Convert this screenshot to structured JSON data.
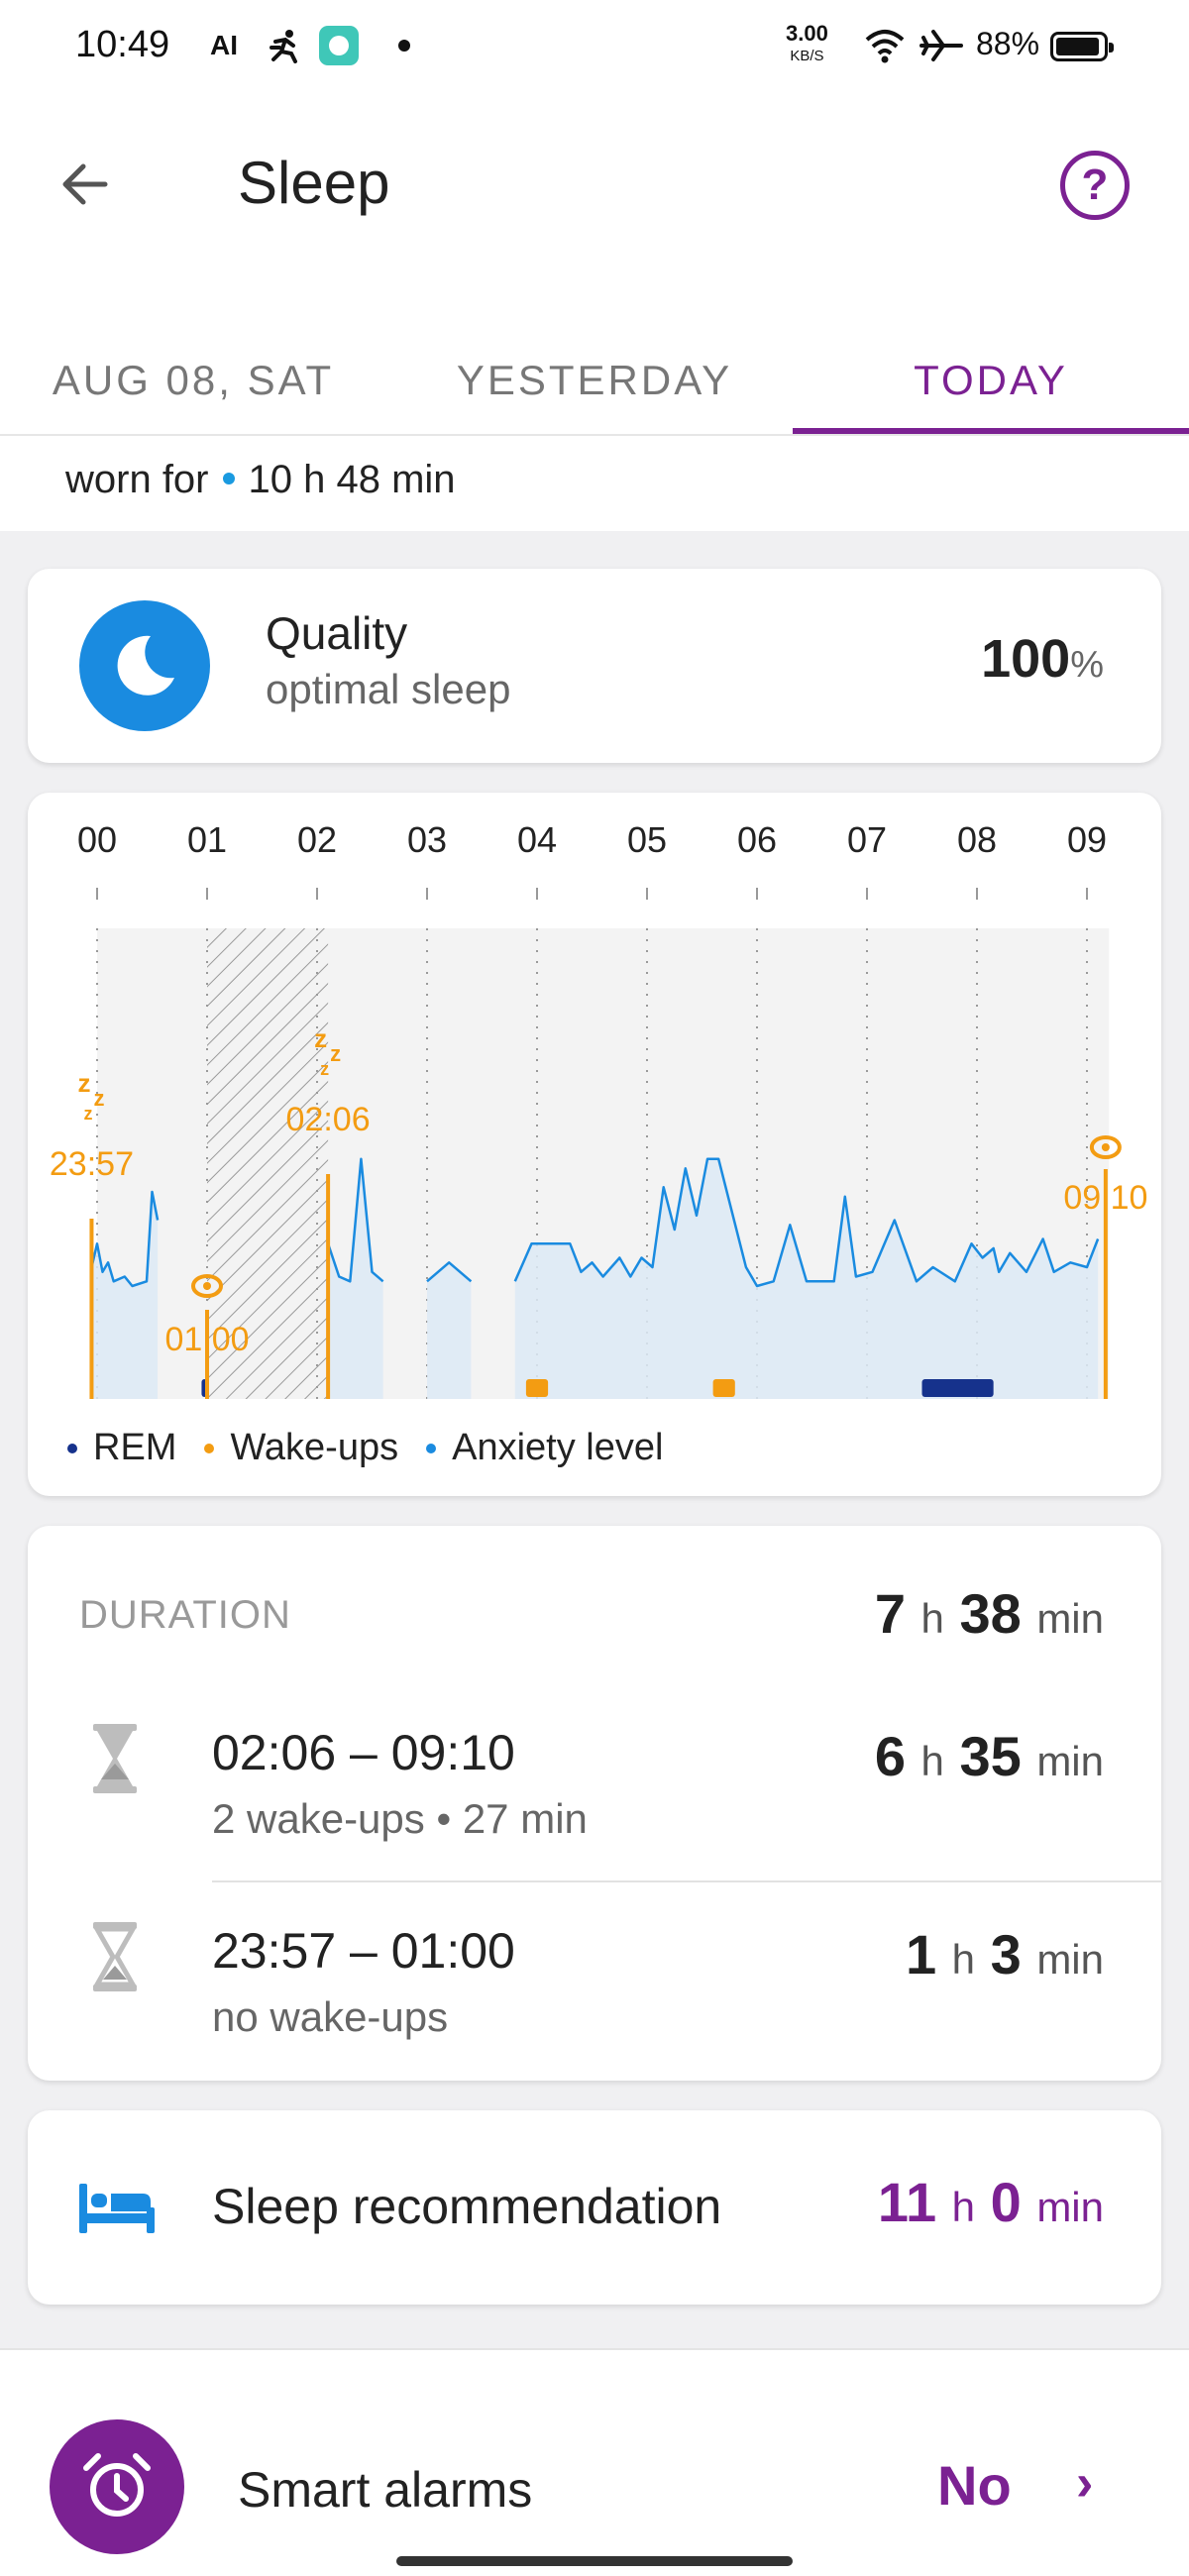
{
  "status_bar": {
    "time": "10:49",
    "ai_badge": "AI",
    "net_speed": "3.00",
    "net_unit": "KB/S",
    "battery": "88%",
    "icons": [
      "ai-icon",
      "fitness-icon",
      "app-icon",
      "notification-dot-icon",
      "wifi-icon",
      "airplane-icon",
      "battery-icon"
    ]
  },
  "header": {
    "title": "Sleep",
    "back_icon": "arrow-left-icon",
    "help_icon": "help-circle-icon",
    "help_glyph": "?"
  },
  "tabs": [
    {
      "label": "AUG 08, SAT",
      "active": false
    },
    {
      "label": "YESTERDAY",
      "active": false
    },
    {
      "label": "TODAY",
      "active": true
    }
  ],
  "worn": {
    "label": "worn for",
    "value": "10 h 48 min"
  },
  "quality": {
    "icon": "moon-icon",
    "title": "Quality",
    "subtitle": "optimal sleep",
    "value": "100",
    "unit": "%"
  },
  "chart_data": {
    "type": "line",
    "hours": [
      "00",
      "01",
      "02",
      "03",
      "04",
      "05",
      "06",
      "07",
      "08",
      "09"
    ],
    "markers": [
      {
        "label": "23:57",
        "kind": "sleep"
      },
      {
        "label": "01:00",
        "kind": "wake"
      },
      {
        "label": "02:06",
        "kind": "sleep"
      },
      {
        "label": "09:10",
        "kind": "wake"
      }
    ],
    "sleep_symbol": "zzz",
    "anxiety_level": [
      [
        -0.05,
        0.28
      ],
      [
        0.0,
        0.33
      ],
      [
        0.05,
        0.27
      ],
      [
        0.1,
        0.29
      ],
      [
        0.15,
        0.25
      ],
      [
        0.25,
        0.26
      ],
      [
        0.32,
        0.24
      ],
      [
        0.45,
        0.25
      ],
      [
        0.5,
        0.44
      ],
      [
        0.55,
        0.38
      ],
      [
        2.1,
        0.33
      ],
      [
        2.2,
        0.26
      ],
      [
        2.3,
        0.25
      ],
      [
        2.4,
        0.51
      ],
      [
        2.5,
        0.27
      ],
      [
        2.6,
        0.25
      ],
      [
        3.0,
        0.25
      ],
      [
        3.2,
        0.29
      ],
      [
        3.4,
        0.25
      ],
      [
        3.8,
        0.25
      ],
      [
        3.95,
        0.33
      ],
      [
        4.15,
        0.33
      ],
      [
        4.3,
        0.33
      ],
      [
        4.4,
        0.27
      ],
      [
        4.5,
        0.29
      ],
      [
        4.6,
        0.26
      ],
      [
        4.75,
        0.3
      ],
      [
        4.85,
        0.26
      ],
      [
        4.95,
        0.3
      ],
      [
        5.05,
        0.28
      ],
      [
        5.15,
        0.45
      ],
      [
        5.25,
        0.36
      ],
      [
        5.35,
        0.49
      ],
      [
        5.45,
        0.39
      ],
      [
        5.55,
        0.51
      ],
      [
        5.65,
        0.51
      ],
      [
        5.9,
        0.28
      ],
      [
        6.0,
        0.24
      ],
      [
        6.15,
        0.25
      ],
      [
        6.3,
        0.37
      ],
      [
        6.45,
        0.25
      ],
      [
        6.7,
        0.25
      ],
      [
        6.8,
        0.43
      ],
      [
        6.9,
        0.26
      ],
      [
        7.05,
        0.27
      ],
      [
        7.25,
        0.38
      ],
      [
        7.45,
        0.25
      ],
      [
        7.6,
        0.28
      ],
      [
        7.8,
        0.25
      ],
      [
        7.95,
        0.33
      ],
      [
        8.05,
        0.3
      ],
      [
        8.15,
        0.32
      ],
      [
        8.2,
        0.27
      ],
      [
        8.3,
        0.31
      ],
      [
        8.45,
        0.27
      ],
      [
        8.6,
        0.34
      ],
      [
        8.7,
        0.27
      ],
      [
        8.85,
        0.29
      ],
      [
        9.0,
        0.28
      ],
      [
        9.1,
        0.34
      ]
    ],
    "rem": [
      [
        0.95,
        1.0
      ],
      [
        7.5,
        8.15
      ]
    ],
    "wake_ups": [
      [
        3.9,
        4.1
      ],
      [
        5.6,
        5.8
      ]
    ],
    "legend": [
      {
        "label": "REM",
        "color": "#16328c"
      },
      {
        "label": "Wake-ups",
        "color": "#f39c12"
      },
      {
        "label": "Anxiety level",
        "color": "#1a8be0"
      }
    ]
  },
  "duration": {
    "label": "DURATION",
    "total": {
      "h": "7",
      "h_unit": "h",
      "m": "38",
      "m_unit": "min"
    },
    "segments": [
      {
        "range": "02:06 – 09:10",
        "note": "2 wake-ups • 27 min",
        "h": "6",
        "m": "35",
        "icon": "hourglass-icon"
      },
      {
        "range": "23:57 – 01:00",
        "note": "no wake-ups",
        "h": "1",
        "m": "3",
        "icon": "hourglass-icon"
      }
    ]
  },
  "recommendation": {
    "icon": "bed-icon",
    "label": "Sleep recommendation",
    "h": "11",
    "h_unit": "h",
    "m": "0",
    "m_unit": "min"
  },
  "smart_alarms": {
    "icon": "alarm-clock-icon",
    "label": "Smart alarms",
    "value": "No",
    "chevron": "›"
  },
  "colors": {
    "accent": "#7b2192",
    "blue": "#1a8be0",
    "orange": "#f39c12",
    "rem": "#16328c"
  }
}
